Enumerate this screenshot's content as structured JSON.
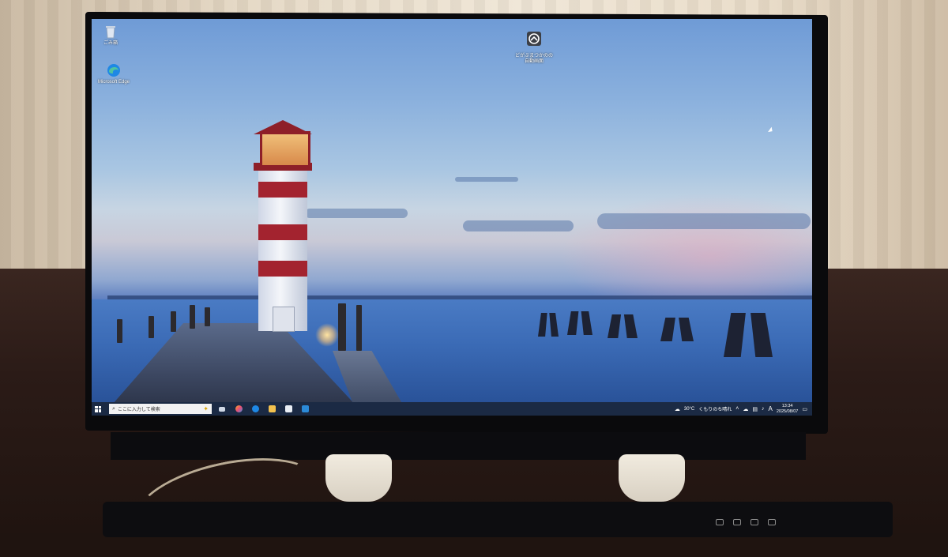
{
  "desktop_icons": [
    {
      "label": "ごみ箱",
      "icon": "recycle-bin-icon"
    },
    {
      "label": "Microsoft Edge",
      "icon": "edge-icon"
    },
    {
      "label": "どがぶまつかのの\n自動画面",
      "icon": "app-shortcut-icon"
    }
  ],
  "taskbar": {
    "search_placeholder": "ここに入力して検索",
    "apps": [
      "task-view-icon",
      "copilot-icon",
      "edge-icon",
      "file-explorer-icon",
      "store-icon",
      "mail-icon"
    ],
    "weather": {
      "temp": "30°C",
      "condition": "くもりのち晴れ",
      "icon": "cloud-sun-icon"
    },
    "ime_indicator": "A",
    "time": "13:34",
    "date": "2025/08/07"
  },
  "colors": {
    "taskbar_bg": "#1b2a44",
    "search_bg": "#f2f2f2",
    "edge_blue": "#1e88e5"
  }
}
